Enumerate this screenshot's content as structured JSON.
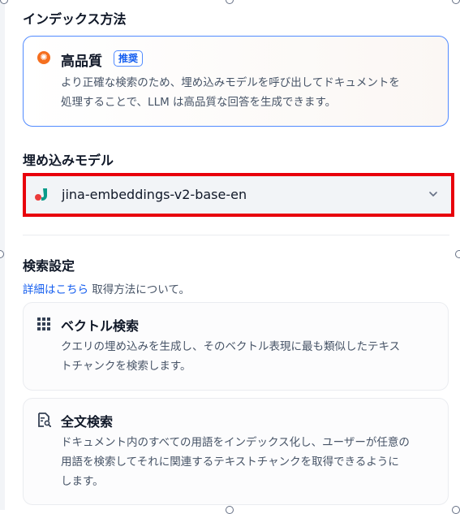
{
  "index_method": {
    "section_title": "インデックス方法",
    "high_quality": {
      "title": "高品質",
      "badge": "推奨",
      "desc_line1": "より正確な検索のため、埋め込みモデルを呼び出してドキュメントを",
      "desc_line2": "処理することで、LLM は高品質な回答を生成できます。"
    }
  },
  "embedding_model": {
    "section_title": "埋め込みモデル",
    "selected": "jina-embeddings-v2-base-en"
  },
  "search_settings": {
    "section_title": "検索設定",
    "link_text": "詳細はこちら",
    "link_suffix": " 取得方法について。",
    "vector": {
      "title": "ベクトル検索",
      "desc_line1": "クエリの埋め込みを生成し、そのベクトル表現に最も類似したテキス",
      "desc_line2": "トチャンクを検索します。"
    },
    "fulltext": {
      "title": "全文検索",
      "desc_line1": "ドキュメント内のすべての用語をインデックス化し、ユーザーが任意の",
      "desc_line2": "用語を検索してそれに関連するテキストチャンクを取得できるように",
      "desc_line3": "します。"
    }
  },
  "colors": {
    "accent": "#155eef",
    "highlight_border": "#e8000b",
    "hq_icon": "#f56f1f",
    "jina_red": "#eb3b3b",
    "jina_teal": "#0a9b8a"
  },
  "icons": [
    "sparkle-icon",
    "jina-logo-icon",
    "chevron-down-icon",
    "grid-icon",
    "document-search-icon"
  ]
}
